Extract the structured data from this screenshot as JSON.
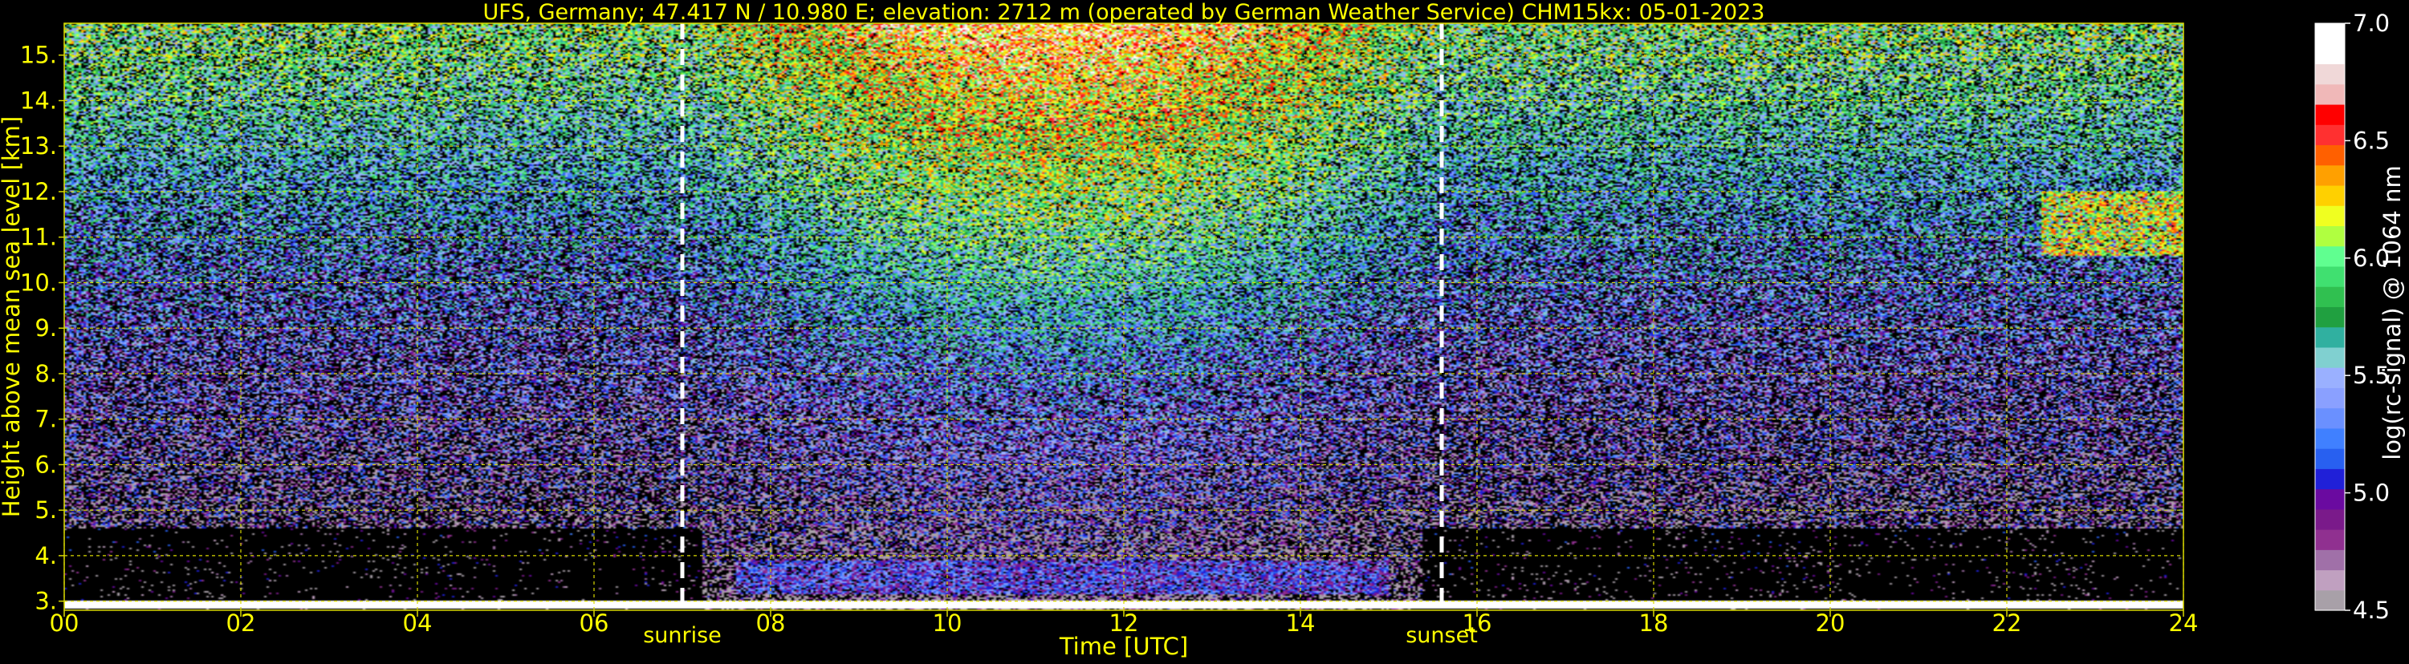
{
  "chart_data": {
    "type": "heatmap",
    "title": "UFS, Germany; 47.417 N / 10.980 E; elevation: 2712 m  (operated by German Weather Service)    CHM15kx: 05-01-2023",
    "xlabel": "Time [UTC]",
    "ylabel": "Height above mean sea level [km]",
    "xlim": [
      0,
      24
    ],
    "ylim": [
      2.8,
      15.7
    ],
    "x_ticks": [
      0,
      2,
      4,
      6,
      8,
      10,
      12,
      14,
      16,
      18,
      20,
      22,
      24
    ],
    "x_tick_labels": [
      "00",
      "02",
      "04",
      "06",
      "08",
      "10",
      "12",
      "14",
      "16",
      "18",
      "20",
      "22",
      "24"
    ],
    "y_ticks": [
      3,
      4,
      5,
      6,
      7,
      8,
      9,
      10,
      11,
      12,
      13,
      14,
      15
    ],
    "y_tick_labels": [
      "3.",
      "4.",
      "5.",
      "6.",
      "7.",
      "8.",
      "9.",
      "10.",
      "11.",
      "12.",
      "13.",
      "14.",
      "15."
    ],
    "grid": true,
    "colorbar": {
      "label": "log(rc-signal) @ 1064 nm",
      "range": [
        4.5,
        7.0
      ],
      "ticks": [
        4.5,
        5.0,
        5.5,
        6.0,
        6.5,
        7.0
      ],
      "tick_labels": [
        "4.5",
        "5.0",
        "5.5",
        "6.0",
        "6.5",
        "7.0"
      ],
      "colors": [
        "#a8a0a8",
        "#c0a0c0",
        "#a070a8",
        "#903090",
        "#7a1a8a",
        "#6a0aa0",
        "#2020d8",
        "#2860f0",
        "#4080ff",
        "#6a90ff",
        "#8aa0ff",
        "#9ab0ff",
        "#80d0d0",
        "#30b0a0",
        "#20a040",
        "#30c050",
        "#40e070",
        "#60ff90",
        "#b0ff40",
        "#f0ff20",
        "#ffd000",
        "#ffa000",
        "#ff6000",
        "#ff3030",
        "#ff0000",
        "#f0b8b8",
        "#f0d8d8",
        "#ffffff",
        "#ffffff"
      ]
    },
    "events": [
      {
        "label": "sunrise",
        "time": 7.0
      },
      {
        "label": "sunset",
        "time": 15.6
      }
    ],
    "features": [
      {
        "kind": "boundary_layer",
        "t0": 7.6,
        "t1": 15.0,
        "y0": 3.15,
        "y1": 3.9,
        "value": 5.1
      },
      {
        "kind": "cloud",
        "t0": 22.4,
        "t1": 24.0,
        "y0": 10.6,
        "y1": 12.0,
        "value": 6.2
      },
      {
        "kind": "ground_return",
        "t0": 0.0,
        "t1": 24.0,
        "y0": 2.85,
        "y1": 3.0,
        "value": 6.9
      }
    ],
    "colors": {
      "text": "#ffff00",
      "grid": "#d8d800",
      "event_line": "#ffffff",
      "background": "#000000",
      "colorbar_text": "#ffffff"
    }
  }
}
